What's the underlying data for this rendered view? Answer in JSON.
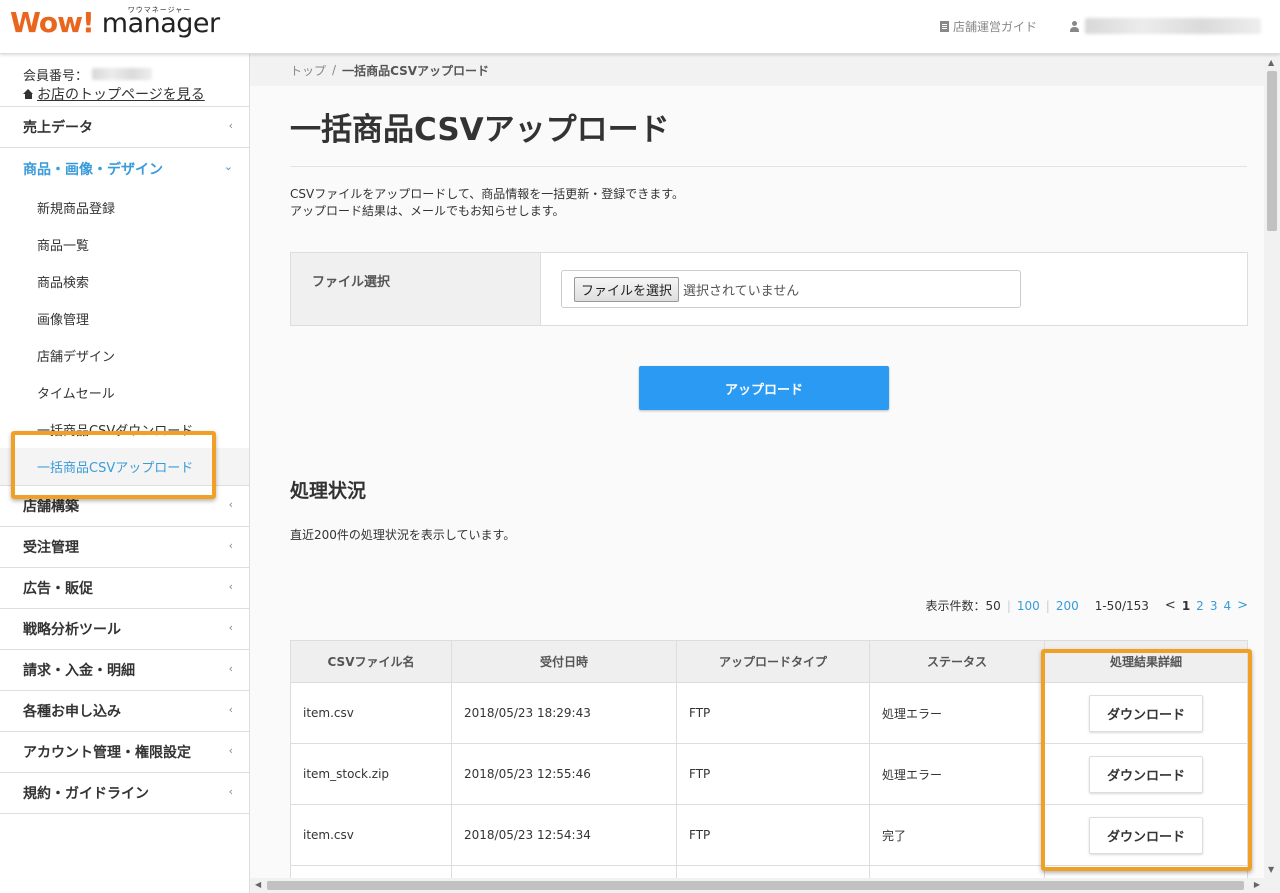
{
  "header": {
    "logo_wow": "Wow!",
    "logo_manager": "manager",
    "logo_kana": "ワウマネージャー",
    "guide_label": "店舗運営ガイド"
  },
  "sidebar": {
    "member_label": "会員番号：",
    "home_link": "お店のトップページを見る",
    "menu": [
      {
        "label": "売上データ"
      },
      {
        "label": "商品・画像・デザイン"
      },
      {
        "label": "店舗構築"
      },
      {
        "label": "受注管理"
      },
      {
        "label": "広告・販促"
      },
      {
        "label": "戦略分析ツール"
      },
      {
        "label": "請求・入金・明細"
      },
      {
        "label": "各種お申し込み"
      },
      {
        "label": "アカウント管理・権限設定"
      },
      {
        "label": "規約・ガイドライン"
      }
    ],
    "submenu": [
      {
        "label": "新規商品登録"
      },
      {
        "label": "商品一覧"
      },
      {
        "label": "商品検索"
      },
      {
        "label": "画像管理"
      },
      {
        "label": "店舗デザイン"
      },
      {
        "label": "タイムセール"
      },
      {
        "label": "一括商品CSVダウンロード"
      },
      {
        "label": "一括商品CSVアップロード"
      }
    ]
  },
  "breadcrumb": {
    "top": "トップ",
    "sep": "/",
    "current": "一括商品CSVアップロード"
  },
  "page": {
    "title": "一括商品CSVアップロード",
    "desc_line1": "CSVファイルをアップロードして、商品情報を一括更新・登録できます。",
    "desc_line2": "アップロード結果は、メールでもお知らせします。",
    "file_label": "ファイル選択",
    "file_button": "ファイルを選択",
    "file_none": "選択されていません",
    "upload_button": "アップロード"
  },
  "status": {
    "title": "処理状況",
    "desc": "直近200件の処理状況を表示しています。",
    "pager": {
      "label": "表示件数：50",
      "opt100": "100",
      "opt200": "200",
      "sep": "|",
      "range": "1-50/153",
      "prev": "<",
      "next": ">",
      "pages": [
        "1",
        "2",
        "3",
        "4"
      ]
    },
    "columns": [
      "CSVファイル名",
      "受付日時",
      "アップロードタイプ",
      "ステータス",
      "処理結果詳細"
    ],
    "rows": [
      {
        "file": "item.csv",
        "date": "2018/05/23 18:29:43",
        "type": "FTP",
        "status": "処理エラー",
        "action": "ダウンロード"
      },
      {
        "file": "item_stock.zip",
        "date": "2018/05/23 12:55:46",
        "type": "FTP",
        "status": "処理エラー",
        "action": "ダウンロード"
      },
      {
        "file": "item.csv",
        "date": "2018/05/23 12:54:34",
        "type": "FTP",
        "status": "完了",
        "action": "ダウンロード"
      }
    ]
  },
  "colors": {
    "accent": "#3a9bd9",
    "upload_button": "#2b9af3",
    "highlight": "#f0a025",
    "logo_orange": "#e9661e"
  }
}
